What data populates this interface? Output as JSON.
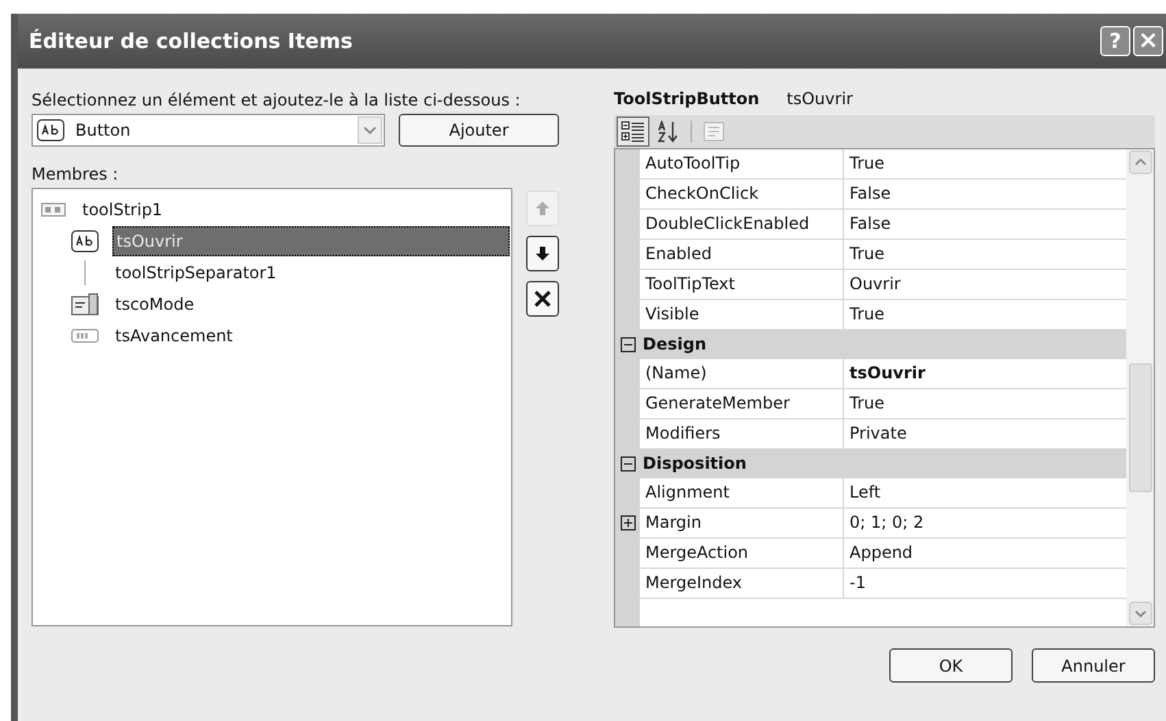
{
  "window": {
    "title": "Éditeur de collections Items",
    "controls": [
      {
        "kind": "help",
        "label": "?"
      },
      {
        "kind": "close",
        "label": "×"
      }
    ]
  },
  "picker": {
    "label": "Sélectionnez un élément et ajoutez-le à la liste ci-dessous :",
    "value": "Button",
    "add_button": "Ajouter"
  },
  "members": {
    "label": "Membres :",
    "items": [
      {
        "kind": "toolstrip",
        "label": "toolStrip1",
        "selected": false,
        "children": [
          {
            "kind": "button",
            "label": "tsOuvrir",
            "selected": true
          },
          {
            "kind": "separator",
            "label": "toolStripSeparator1",
            "selected": false
          },
          {
            "kind": "combobox",
            "label": "tscoMode",
            "selected": false
          },
          {
            "kind": "progress",
            "label": "tsAvancement",
            "selected": false
          }
        ]
      }
    ],
    "actions": [
      {
        "kind": "up",
        "disabled": true
      },
      {
        "kind": "down",
        "disabled": false
      },
      {
        "kind": "delete",
        "disabled": false
      }
    ]
  },
  "properties": {
    "type": "ToolStripButton",
    "name": "tsOuvrir",
    "toolbar": [
      {
        "kind": "categorized",
        "selected": true,
        "disabled": false
      },
      {
        "kind": "alphabetical",
        "selected": false,
        "disabled": false
      },
      {
        "kind": "pages",
        "selected": false,
        "disabled": true
      }
    ],
    "rows": [
      {
        "kind": "property",
        "name": "AutoToolTip",
        "value": "True",
        "modified": false
      },
      {
        "kind": "property",
        "name": "CheckOnClick",
        "value": "False",
        "modified": false
      },
      {
        "kind": "property",
        "name": "DoubleClickEnabled",
        "value": "False",
        "modified": false
      },
      {
        "kind": "property",
        "name": "Enabled",
        "value": "True",
        "modified": false
      },
      {
        "kind": "property",
        "name": "ToolTipText",
        "value": "Ouvrir",
        "modified": false
      },
      {
        "kind": "property",
        "name": "Visible",
        "value": "True",
        "modified": false
      },
      {
        "kind": "category",
        "name": "Design",
        "expanded": true
      },
      {
        "kind": "property",
        "name": "(Name)",
        "value": "tsOuvrir",
        "modified": true
      },
      {
        "kind": "property",
        "name": "GenerateMember",
        "value": "True",
        "modified": false
      },
      {
        "kind": "property",
        "name": "Modifiers",
        "value": "Private",
        "modified": false
      },
      {
        "kind": "category",
        "name": "Disposition",
        "expanded": true
      },
      {
        "kind": "property",
        "name": "Alignment",
        "value": "Left",
        "modified": false
      },
      {
        "kind": "group",
        "name": "Margin",
        "value": "0; 1; 0; 2",
        "expanded": false,
        "modified": false
      },
      {
        "kind": "property",
        "name": "MergeAction",
        "value": "Append",
        "modified": false
      },
      {
        "kind": "property",
        "name": "MergeIndex",
        "value": "-1",
        "modified": false
      }
    ]
  },
  "buttons": [
    {
      "label": "OK"
    },
    {
      "label": "Annuler"
    }
  ]
}
